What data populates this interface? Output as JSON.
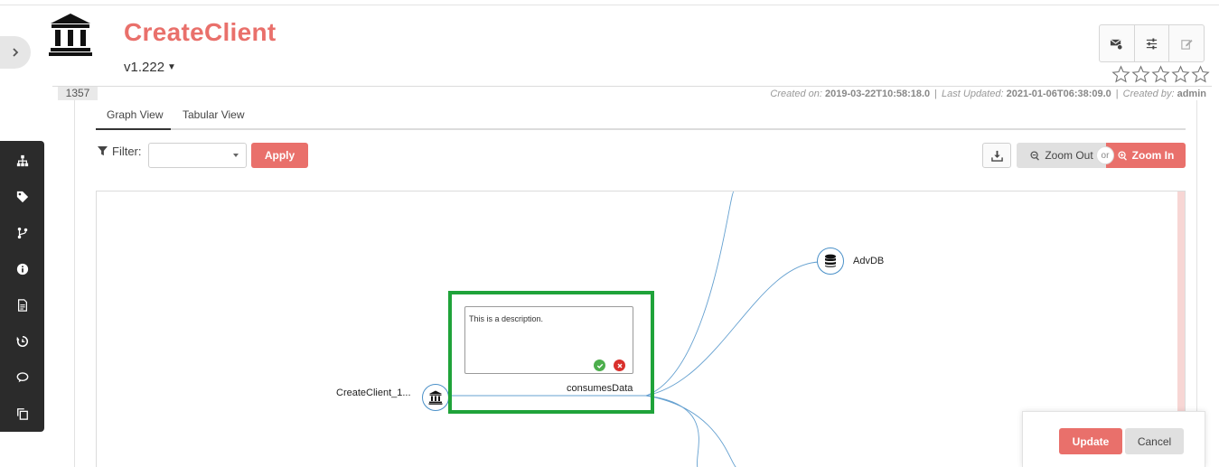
{
  "header": {
    "title": "CreateClient",
    "version": "v1.222",
    "id_badge": "1357",
    "meta": {
      "created_label": "Created on:",
      "created_value": "2019-03-22T10:58:18.0",
      "updated_label": "Last Updated:",
      "updated_value": "2021-01-06T06:38:09.0",
      "created_by_label": "Created by:",
      "created_by_value": "admin"
    },
    "rating": 0,
    "rating_max": 5
  },
  "tabs": [
    {
      "label": "Graph View",
      "active": true
    },
    {
      "label": "Tabular View",
      "active": false
    }
  ],
  "toolbar": {
    "filter_label": "Filter:",
    "filter_value": "",
    "apply_label": "Apply",
    "zoom_out_label": "Zoom Out",
    "or_label": "or",
    "zoom_in_label": "Zoom In"
  },
  "graph": {
    "nodes": [
      {
        "label": "CreateClient_1...",
        "icon": "bank-icon"
      },
      {
        "label": "AdvDB",
        "icon": "database-icon"
      }
    ],
    "edge_label": "consumesData",
    "description_text": "This is a description."
  },
  "sidebar": {
    "icons": [
      "hierarchy-icon",
      "tag-icon",
      "branch-icon",
      "info-icon",
      "document-icon",
      "history-icon",
      "comments-icon",
      "copy-icon"
    ]
  },
  "actions": {
    "update_label": "Update",
    "cancel_label": "Cancel"
  },
  "colors": {
    "accent": "#e9706b",
    "highlight": "#1fa33a",
    "edge": "#4a90c8"
  }
}
